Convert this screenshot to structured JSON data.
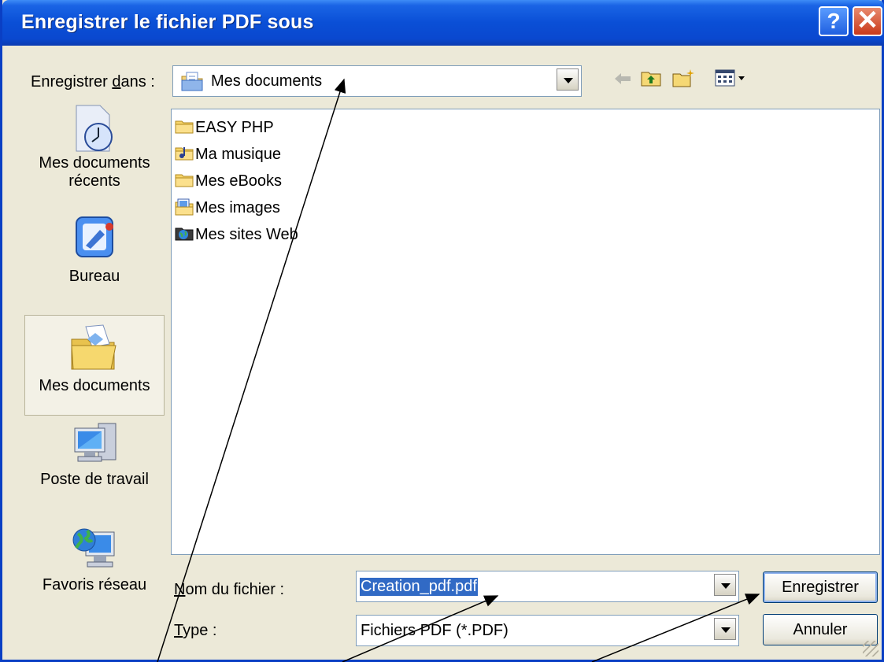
{
  "window": {
    "title": "Enregistrer le fichier PDF sous",
    "help_label": "?",
    "close_label": "✕"
  },
  "save_in": {
    "label": "Enregistrer dans :",
    "value": "Mes documents"
  },
  "places": [
    {
      "label_line1": "Mes documents",
      "label_line2": "récents",
      "icon": "recent-documents-icon"
    },
    {
      "label_line1": "Bureau",
      "icon": "desktop-icon"
    },
    {
      "label_line1": "Mes documents",
      "icon": "my-documents-folder-icon",
      "selected": true
    },
    {
      "label_line1": "Poste de travail",
      "icon": "my-computer-icon"
    },
    {
      "label_line1": "Favoris réseau",
      "icon": "network-places-icon"
    }
  ],
  "files": [
    {
      "name": "EASY PHP",
      "icon": "folder-icon"
    },
    {
      "name": "Ma musique",
      "icon": "music-folder-icon"
    },
    {
      "name": "Mes eBooks",
      "icon": "folder-icon"
    },
    {
      "name": "Mes images",
      "icon": "pictures-folder-icon"
    },
    {
      "name": "Mes sites Web",
      "icon": "web-folder-icon"
    }
  ],
  "filename": {
    "label": "Nom du fichier :",
    "value": "Creation_pdf.pdf"
  },
  "filetype": {
    "label": "Type :",
    "value": "Fichiers PDF (*.PDF)"
  },
  "buttons": {
    "save": "Enregistrer",
    "cancel": "Annuler"
  },
  "colors": {
    "titlebar": "#0a4fd6",
    "dialog_bg": "#ece9d8",
    "selection": "#316ac5"
  }
}
